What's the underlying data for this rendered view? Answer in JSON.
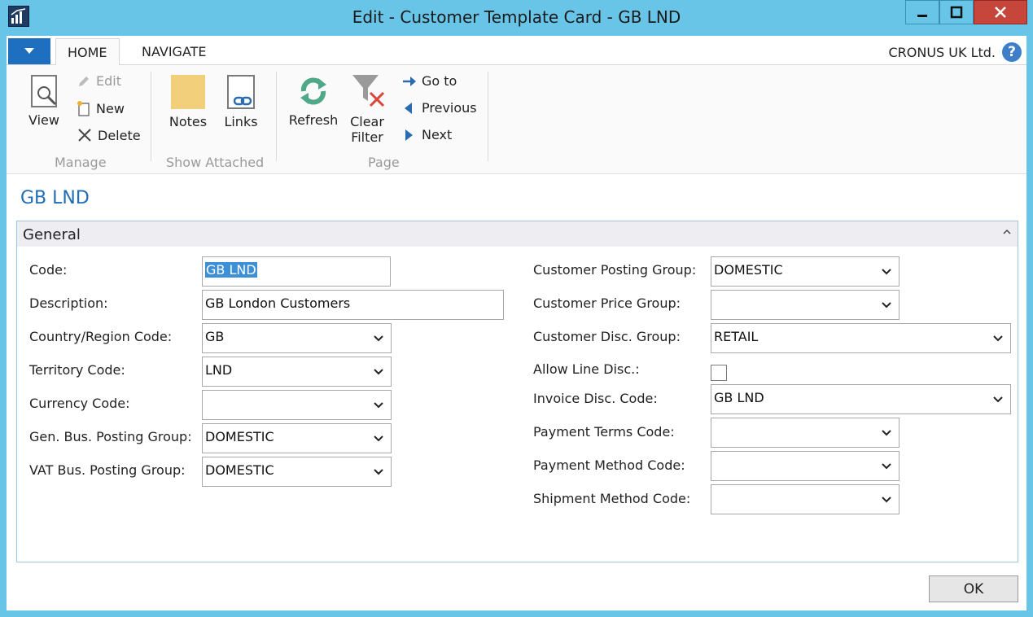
{
  "window": {
    "title": "Edit - Customer Template Card - GB LND",
    "app_icon": "dynamics-nav-icon"
  },
  "ribbon": {
    "tabs": [
      {
        "label": "HOME",
        "active": true
      },
      {
        "label": "NAVIGATE",
        "active": false
      }
    ],
    "company": "CRONUS UK Ltd.",
    "groups": {
      "manage": {
        "label": "Manage",
        "view": "View",
        "edit": "Edit",
        "new": "New",
        "delete": "Delete"
      },
      "show_attached": {
        "label": "Show Attached",
        "notes": "Notes",
        "links": "Links"
      },
      "page": {
        "label": "Page",
        "refresh": "Refresh",
        "clear_filter_1": "Clear",
        "clear_filter_2": "Filter",
        "go_to": "Go to",
        "previous": "Previous",
        "next": "Next"
      }
    }
  },
  "page": {
    "title": "GB LND"
  },
  "general": {
    "header": "General",
    "left": {
      "code": {
        "label": "Code:",
        "value": "GB LND"
      },
      "description": {
        "label": "Description:",
        "value": "GB London Customers"
      },
      "country": {
        "label": "Country/Region Code:",
        "value": "GB"
      },
      "territory": {
        "label": "Territory Code:",
        "value": "LND"
      },
      "currency": {
        "label": "Currency Code:",
        "value": ""
      },
      "gen_bus": {
        "label": "Gen. Bus. Posting Group:",
        "value": "DOMESTIC"
      },
      "vat_bus": {
        "label": "VAT Bus. Posting Group:",
        "value": "DOMESTIC"
      }
    },
    "right": {
      "cust_posting": {
        "label": "Customer Posting Group:",
        "value": "DOMESTIC"
      },
      "cust_price": {
        "label": "Customer Price Group:",
        "value": ""
      },
      "cust_disc": {
        "label": "Customer Disc. Group:",
        "value": "RETAIL"
      },
      "allow_line_disc": {
        "label": "Allow Line Disc.:",
        "checked": false
      },
      "invoice_disc": {
        "label": "Invoice Disc. Code:",
        "value": "GB LND"
      },
      "payment_terms": {
        "label": "Payment Terms Code:",
        "value": ""
      },
      "payment_method": {
        "label": "Payment Method Code:",
        "value": ""
      },
      "shipment_method": {
        "label": "Shipment Method Code:",
        "value": ""
      }
    }
  },
  "footer": {
    "ok": "OK"
  }
}
